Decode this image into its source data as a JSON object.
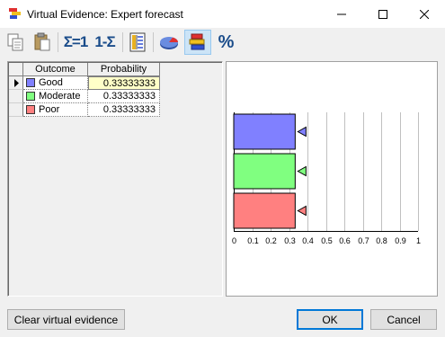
{
  "window": {
    "title": "Virtual Evidence: Expert forecast",
    "controls": [
      "minimize-icon",
      "maximize-icon",
      "close-icon"
    ]
  },
  "toolbar": {
    "sum_one_label": "Σ=1",
    "one_minus_sum_label": "1-Σ",
    "percent_label": "%",
    "icons": [
      "copy-icon",
      "paste-icon",
      "normalize-icon",
      "complement-icon",
      "table-icon",
      "pie-chart-icon",
      "bar-chart-icon",
      "percent-icon"
    ],
    "active": "bar-chart-icon"
  },
  "table": {
    "headers": {
      "outcome": "Outcome",
      "probability": "Probability"
    },
    "rows": [
      {
        "outcome": "Good",
        "probability": "0.33333333",
        "color": "#8080ff",
        "selected": true
      },
      {
        "outcome": "Moderate",
        "probability": "0.33333333",
        "color": "#80ff80",
        "selected": false
      },
      {
        "outcome": "Poor",
        "probability": "0.33333333",
        "color": "#ff8080",
        "selected": false
      }
    ]
  },
  "chart_data": {
    "type": "bar",
    "orientation": "horizontal",
    "categories": [
      "Good",
      "Moderate",
      "Poor"
    ],
    "values": [
      0.33333333,
      0.33333333,
      0.33333333
    ],
    "colors": [
      "#8080ff",
      "#80ff80",
      "#ff8080"
    ],
    "xlim": [
      0,
      1
    ],
    "ticks": [
      "0",
      "0.1",
      "0.2",
      "0.3",
      "0.4",
      "0.5",
      "0.6",
      "0.7",
      "0.8",
      "0.9",
      "1"
    ],
    "grid": true,
    "draggable_handles": true
  },
  "buttons": {
    "clear": "Clear virtual evidence",
    "ok": "OK",
    "cancel": "Cancel"
  }
}
